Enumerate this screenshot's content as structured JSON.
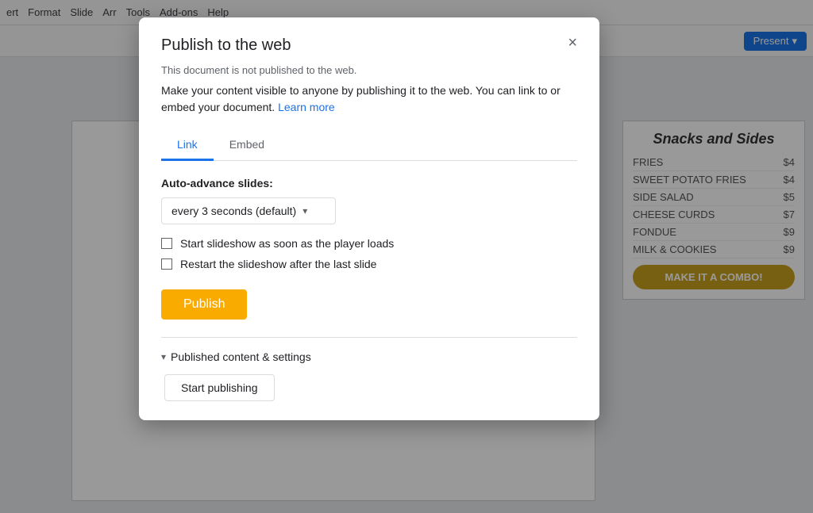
{
  "topbar": {
    "items": [
      "ert",
      "Format",
      "Slide",
      "Arr",
      "Tools",
      "Add-ons",
      "Help"
    ]
  },
  "toolbar": {
    "present_label": "Present",
    "present_arrow": "▾"
  },
  "right_panel": {
    "title": "Snacks and Sides",
    "items": [
      {
        "name": "FRIES",
        "price": "$4"
      },
      {
        "name": "SWEET POTATO FRIES",
        "price": "$4"
      },
      {
        "name": "SIDE SALAD",
        "price": "$5"
      },
      {
        "name": "CHEESE CURDS",
        "price": "$7"
      },
      {
        "name": "FONDUE",
        "price": "$9"
      },
      {
        "name": "MILK & COOKIES",
        "price": "$9"
      }
    ],
    "combo_text": "MAKE IT A COMBO!"
  },
  "dialog": {
    "title": "Publish to the web",
    "close_label": "×",
    "not_published_text": "This document is not published to the web.",
    "description": "Make your content visible to anyone by publishing it to the web. You can link to or embed your document.",
    "learn_more": "Learn more",
    "tabs": [
      {
        "id": "link",
        "label": "Link",
        "active": true
      },
      {
        "id": "embed",
        "label": "Embed",
        "active": false
      }
    ],
    "auto_advance_label": "Auto-advance slides:",
    "auto_advance_value": "every 3 seconds (default)",
    "checkboxes": [
      {
        "id": "start-slideshow",
        "label": "Start slideshow as soon as the player loads",
        "checked": false
      },
      {
        "id": "restart-slideshow",
        "label": "Restart the slideshow after the last slide",
        "checked": false
      }
    ],
    "publish_button_label": "Publish",
    "published_content_section": {
      "label": "Published content & settings",
      "chevron": "▾"
    },
    "start_publishing_button_label": "Start publishing"
  }
}
